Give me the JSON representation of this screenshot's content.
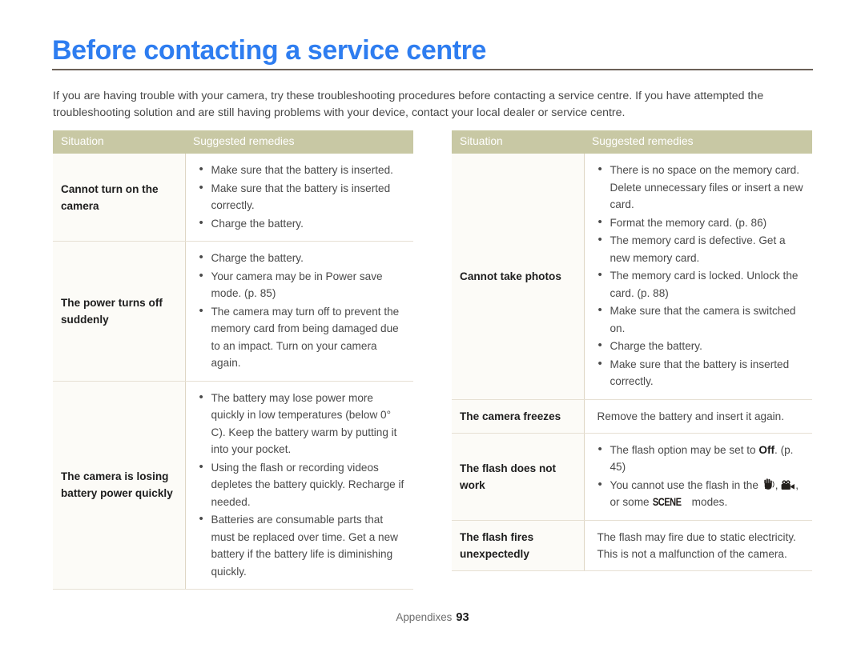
{
  "page": {
    "title": "Before contacting a service centre",
    "intro": "If you are having trouble with your camera, try these troubleshooting procedures before contacting a service centre. If you have attempted the troubleshooting solution and are still having problems with your device, contact your local dealer or service centre.",
    "accent_color": "#2e7df0",
    "rule_color": "#6b6158",
    "header_bg_color": "#c8c8a4",
    "situation_cell_bg": "#fcfbf7",
    "border_color": "#e6e0d3"
  },
  "tables": {
    "left": {
      "headers": {
        "situation": "Situation",
        "remedies": "Suggested remedies"
      },
      "rows": [
        {
          "situation": "Cannot turn on the camera",
          "remedies": [
            "Make sure that the battery is inserted.",
            "Make sure that the battery is inserted correctly.",
            "Charge the battery."
          ]
        },
        {
          "situation": "The power turns off suddenly",
          "remedies": [
            "Charge the battery.",
            "Your camera may be in Power save mode. (p. 85)",
            "The camera may turn off to prevent the memory card from being damaged due to an impact. Turn on your camera again."
          ]
        },
        {
          "situation": "The camera is losing battery power quickly",
          "remedies": [
            "The battery may lose power more quickly in low temperatures (below 0° C). Keep the battery warm by putting it into your pocket.",
            "Using the flash or recording videos depletes the battery quickly. Recharge if needed.",
            "Batteries are consumable parts that must be replaced over time. Get a new battery if the battery life is diminishing quickly."
          ]
        }
      ]
    },
    "right": {
      "headers": {
        "situation": "Situation",
        "remedies": "Suggested remedies"
      },
      "rows": [
        {
          "situation": "Cannot take photos",
          "remedies": [
            "There is no space on the memory card. Delete unnecessary files or insert a new card.",
            "Format the memory card. (p. 86)",
            "The memory card is defective. Get a new memory card.",
            "The memory card is locked. Unlock the card. (p. 88)",
            "Make sure that the camera is switched on.",
            "Charge the battery.",
            "Make sure that the battery is inserted correctly."
          ]
        },
        {
          "situation": "The camera freezes",
          "plain": "Remove the battery and insert it again."
        },
        {
          "situation": "The flash does not work",
          "flash_bullets": {
            "b1_pre": "The flash option may be set to ",
            "b1_bold": "Off",
            "b1_post": ". (p. 45)",
            "b2_pre": "You cannot use the flash in the ",
            "b2_mid": ", ",
            "b2_or": ", or some ",
            "b2_scene": "SCENE",
            "b2_post": " modes."
          }
        },
        {
          "situation": "The flash fires unexpectedly",
          "plain": "The flash may fire due to static electricity. This is not a malfunction of the camera."
        }
      ]
    }
  },
  "footer": {
    "section": "Appendixes",
    "page_number": "93"
  },
  "icons": {
    "dis_mode": "hand-shake-icon",
    "movie_mode": "movie-camera-icon",
    "scene_mode": "scene-mode-icon"
  }
}
